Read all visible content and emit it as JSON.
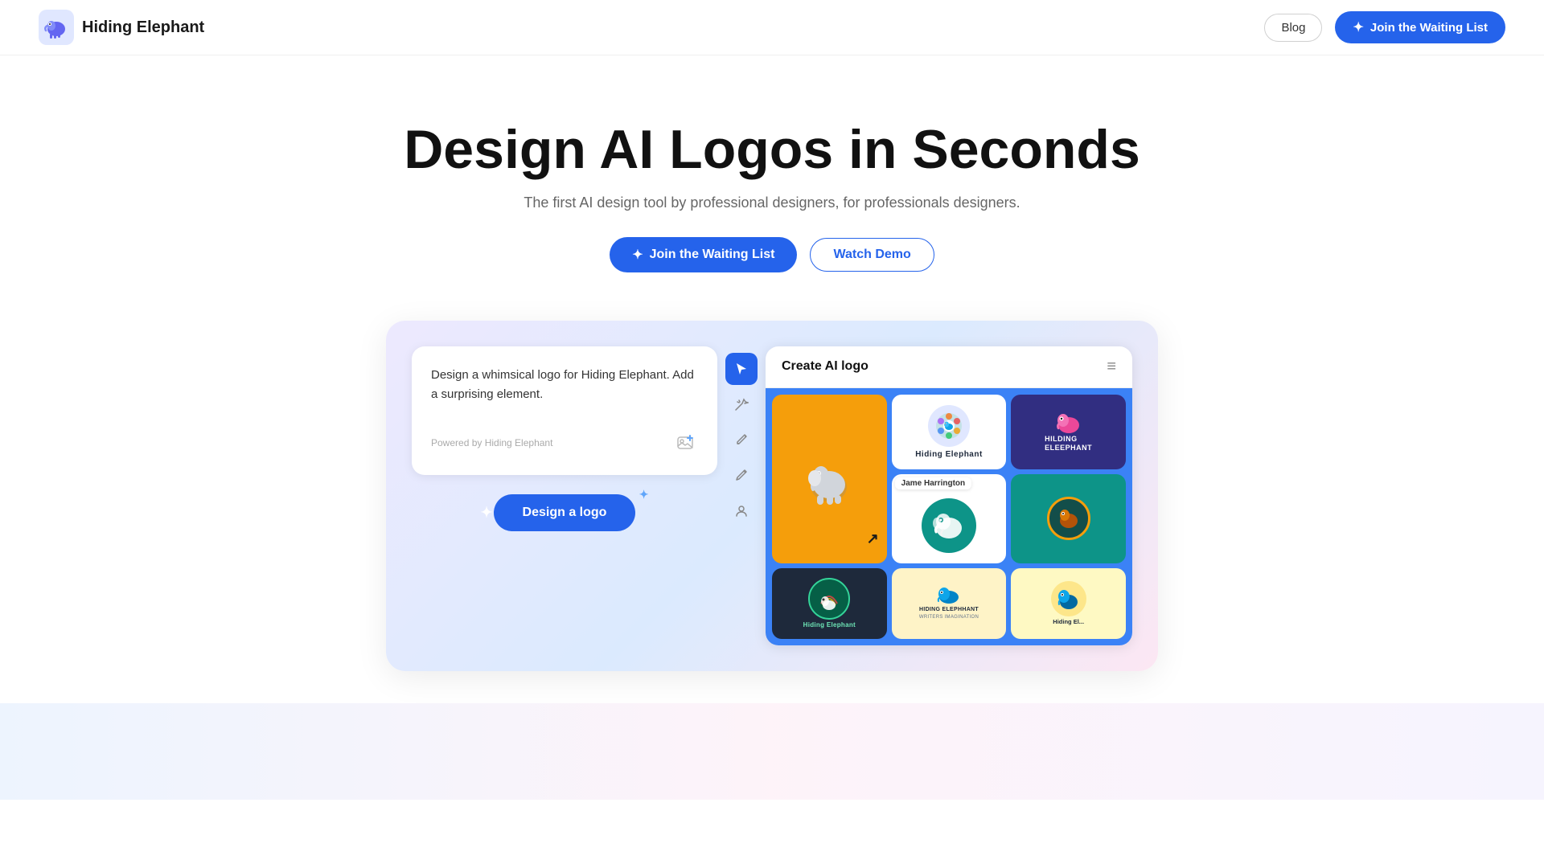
{
  "nav": {
    "logo_text": "Hiding Elephant",
    "blog_label": "Blog",
    "waitlist_label": "Join the Waiting List"
  },
  "hero": {
    "title": "Design AI Logos in Seconds",
    "subtitle": "The first AI design tool by professional designers, for professionals designers.",
    "cta_waitlist": "Join the Waiting List",
    "cta_demo": "Watch Demo"
  },
  "mockup": {
    "prompt_text": "Design a whimsical logo for Hiding Elephant. Add a surprising element.",
    "powered_by": "Powered by Hiding Elephant",
    "design_btn": "Design a logo",
    "panel_title": "Create AI logo",
    "tooltip_user": "Jame Harrington"
  }
}
